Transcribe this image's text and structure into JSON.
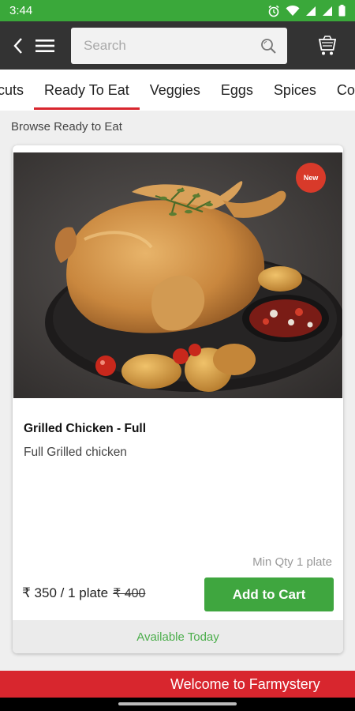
{
  "status_bar": {
    "time": "3:44",
    "icons": [
      "alarm-icon",
      "wifi-icon",
      "signal-icon",
      "signal-icon",
      "battery-icon"
    ]
  },
  "app_bar": {
    "search_placeholder": "Search",
    "icons": [
      "back-icon",
      "menu-icon",
      "search-icon",
      "cart-icon"
    ]
  },
  "tabs": [
    {
      "label": "cuts",
      "active": false
    },
    {
      "label": "Ready To Eat",
      "active": true
    },
    {
      "label": "Veggies",
      "active": false
    },
    {
      "label": "Eggs",
      "active": false
    },
    {
      "label": "Spices",
      "active": false
    },
    {
      "label": "Com",
      "active": false
    }
  ],
  "section": {
    "title": "Browse Ready to Eat"
  },
  "product": {
    "badge": "New",
    "name": "Grilled Chicken - Full",
    "description": "Full Grilled chicken",
    "min_qty": "Min Qty 1 plate",
    "price": "₹ 350 / 1 plate",
    "old_price": "₹ 400",
    "add_to_cart": "Add to Cart",
    "availability": "Available Today"
  },
  "footer": {
    "welcome": "Welcome to Farmystery"
  },
  "colors": {
    "status_bar": "#3aa83a",
    "app_bar": "#333333",
    "accent_red": "#d8262e",
    "button_green": "#3fa63f"
  }
}
